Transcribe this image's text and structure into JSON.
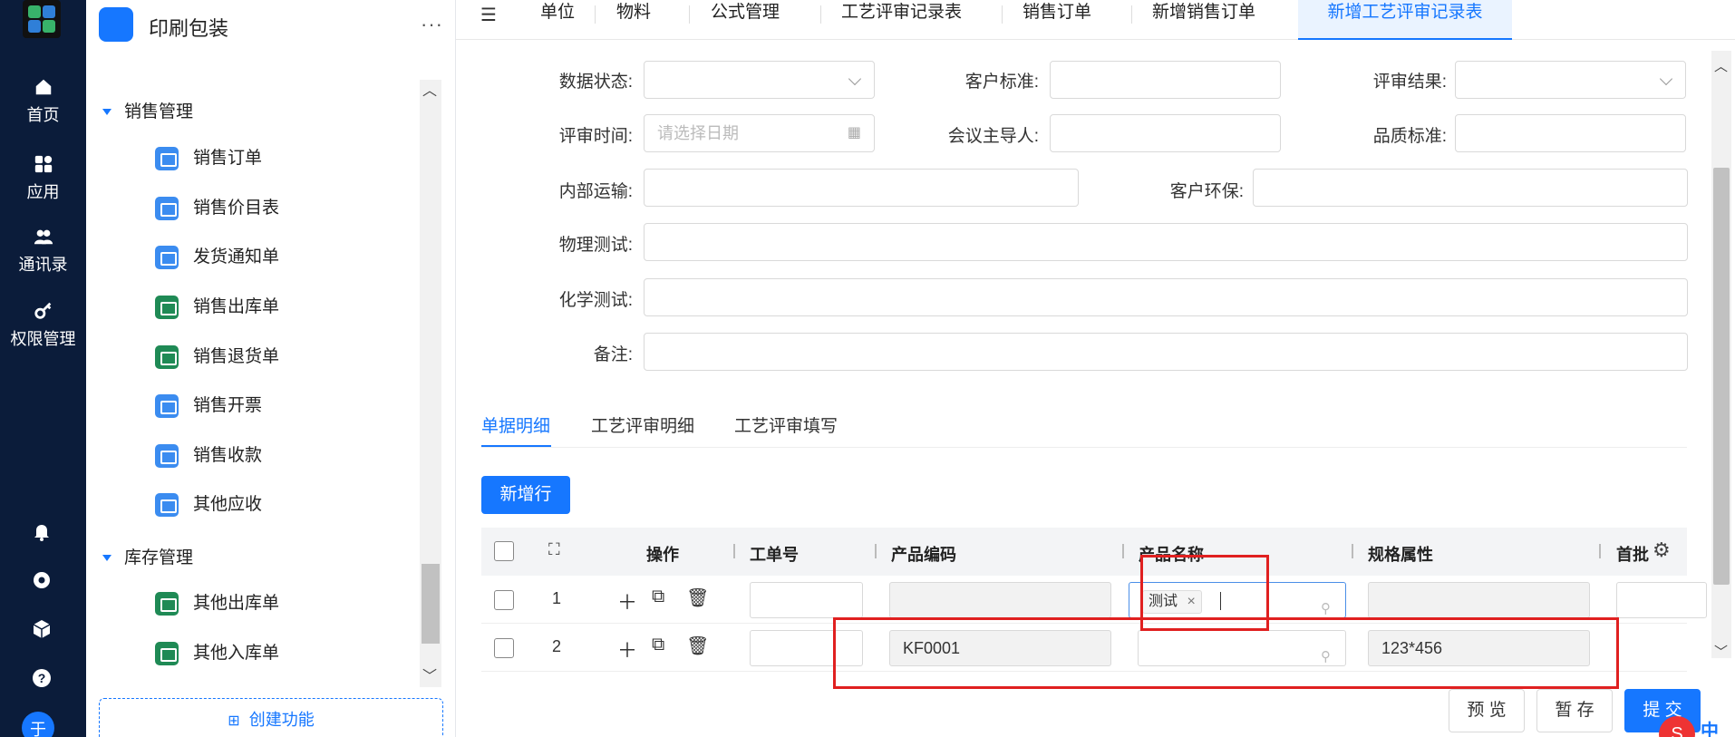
{
  "rail": {
    "items": [
      {
        "label": "首页",
        "icon": "home-icon"
      },
      {
        "label": "应用",
        "icon": "apps-icon"
      },
      {
        "label": "通讯录",
        "icon": "contacts-icon"
      },
      {
        "label": "权限管理",
        "icon": "key-icon"
      }
    ],
    "avatar": "于"
  },
  "side": {
    "title": "印刷包装",
    "more": "···",
    "groups": [
      {
        "label": "销售管理",
        "items": [
          "销售订单",
          "销售价目表",
          "发货通知单",
          "销售出库单",
          "销售退货单",
          "销售开票",
          "销售收款",
          "其他应收"
        ]
      },
      {
        "label": "库存管理",
        "items": [
          "其他出库单",
          "其他入库单"
        ]
      }
    ],
    "create_label": "创建功能"
  },
  "tabs": [
    "单位",
    "物料",
    "公式管理",
    "工艺评审记录表",
    "销售订单",
    "新增销售订单",
    "新增工艺评审记录表"
  ],
  "form": {
    "data_status": "数据状态:",
    "customer_std": "客户标准:",
    "review_result": "评审结果:",
    "review_time": "评审时间:",
    "review_time_placeholder": "请选择日期",
    "meeting_host": "会议主导人:",
    "quality_std": "品质标准:",
    "internal_transport": "内部运输:",
    "customer_env": "客户环保:",
    "physical_test": "物理测试:",
    "chemical_test": "化学测试:",
    "remark": "备注:"
  },
  "inner_tabs": [
    "单据明细",
    "工艺评审明细",
    "工艺评审填写"
  ],
  "add_row": "新增行",
  "table": {
    "headers": {
      "op": "操作",
      "work_no": "工单号",
      "product_code": "产品编码",
      "product_name": "产品名称",
      "spec": "规格属性",
      "first": "首批"
    },
    "rows": [
      {
        "num": "1",
        "work_no": "",
        "product_code": "",
        "product_name_tag": "测试",
        "spec": ""
      },
      {
        "num": "2",
        "work_no": "",
        "product_code": "KF0001",
        "product_name_tag": "",
        "spec": "123*456"
      }
    ]
  },
  "footer": {
    "preview": "预 览",
    "save_draft": "暂 存",
    "submit": "提 交"
  },
  "ime": {
    "logo": "S",
    "label": "中"
  }
}
